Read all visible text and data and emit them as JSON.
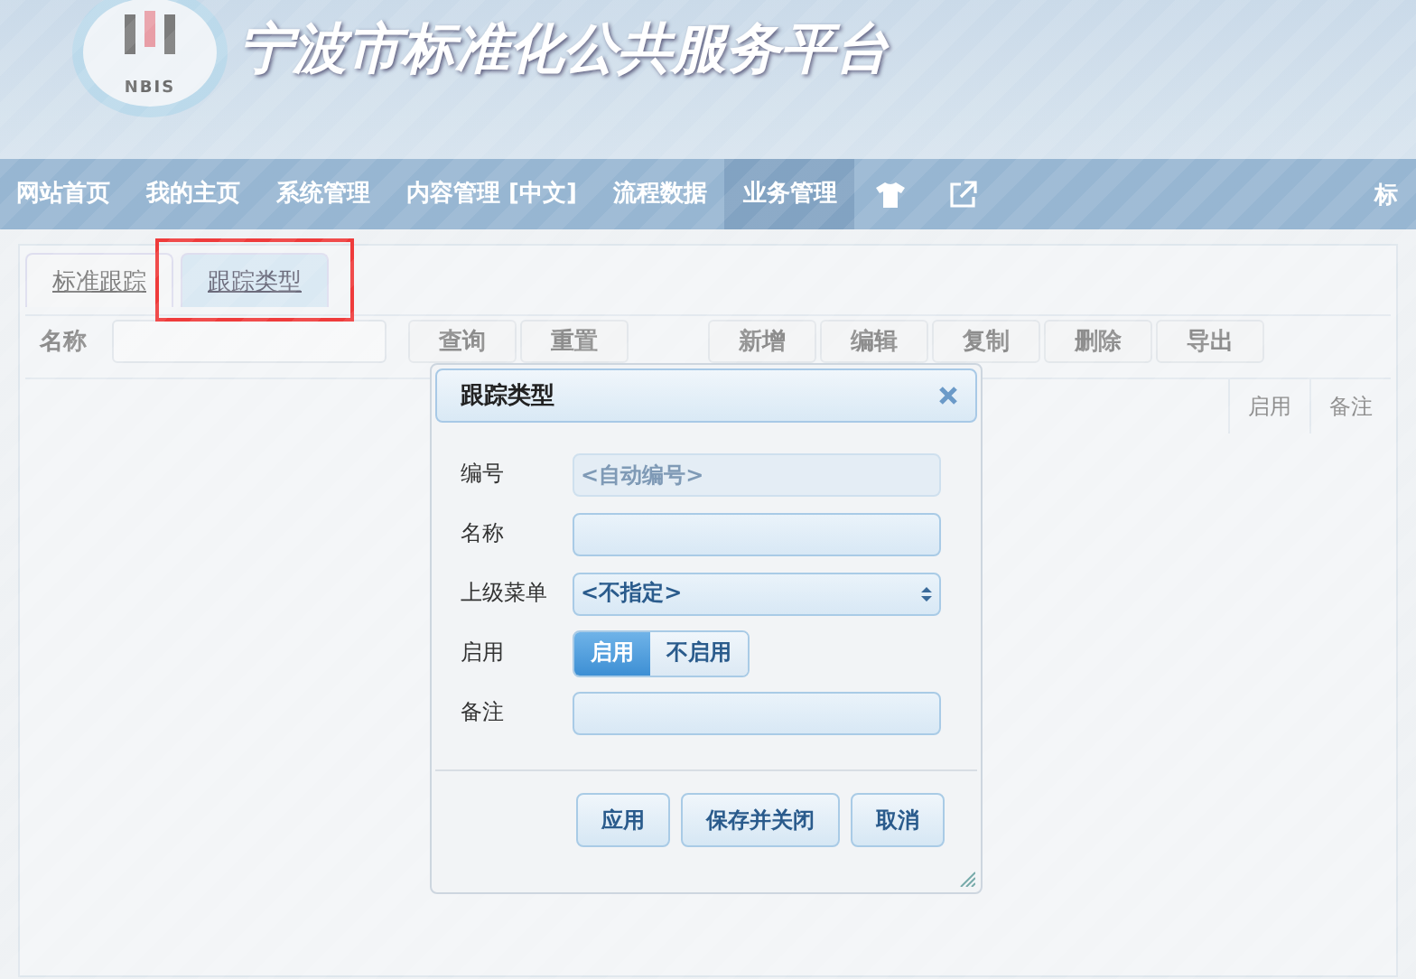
{
  "header": {
    "logo_text": "NBIS",
    "title": "宁波市标准化公共服务平台"
  },
  "nav": [
    {
      "label": "网站首页",
      "selected": false
    },
    {
      "label": "我的主页",
      "selected": false
    },
    {
      "label": "系统管理",
      "selected": false
    },
    {
      "label": "内容管理 [中文]",
      "selected": false
    },
    {
      "label": "流程数据",
      "selected": false
    },
    {
      "label": "业务管理",
      "selected": true
    }
  ],
  "nav_right": "标",
  "tabs": [
    {
      "label": "标准跟踪",
      "selected": false,
      "highlighted": false
    },
    {
      "label": "跟踪类型",
      "selected": true,
      "highlighted": true
    }
  ],
  "toolbar": {
    "search_label": "名称",
    "search_buttons": [
      "查询",
      "重置"
    ],
    "actions": [
      "新增",
      "编辑",
      "复制",
      "删除",
      "导出"
    ]
  },
  "table": {
    "columns": [
      "启用",
      "备注"
    ]
  },
  "dialog": {
    "title": "跟踪类型",
    "fields": [
      {
        "kind": "input",
        "label": "编号",
        "placeholder": "<自动编号>",
        "disabled": true
      },
      {
        "kind": "input",
        "label": "名称",
        "disabled": false
      },
      {
        "kind": "select",
        "label": "上级菜单",
        "value": "<不指定>"
      },
      {
        "kind": "toggle",
        "label": "启用",
        "options": [
          {
            "label": "启用",
            "selected": true
          },
          {
            "label": "不启用",
            "selected": false
          }
        ]
      },
      {
        "kind": "input",
        "label": "备注",
        "disabled": false
      }
    ],
    "buttons": [
      "应用",
      "保存并关闭",
      "取消"
    ]
  }
}
